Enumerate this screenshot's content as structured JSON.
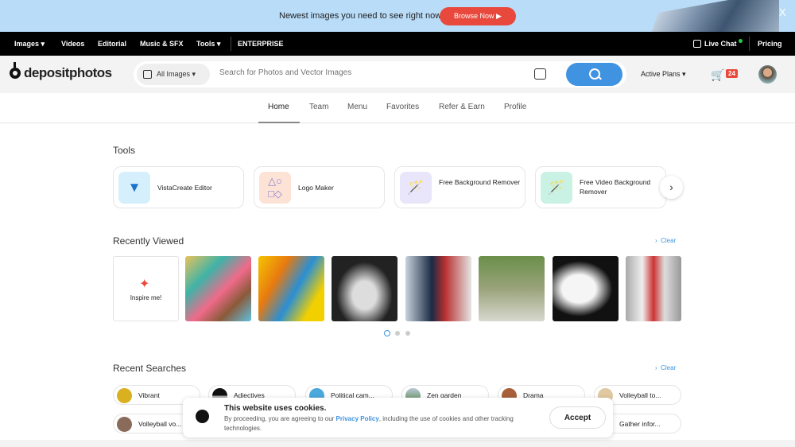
{
  "banner": {
    "text": "Newest images you need to see right now",
    "button": "Browse Now ▶",
    "close": "X"
  },
  "topnav": {
    "items": [
      "Images ▾",
      "Videos",
      "Editorial",
      "Music & SFX",
      "Tools ▾",
      "ENTERPRISE"
    ],
    "live_chat": "Live Chat",
    "pricing": "Pricing"
  },
  "header": {
    "logo": "depositphotos",
    "filter": "All Images ▾",
    "search_placeholder": "Search for Photos and Vector Images",
    "plans": "Active Plans ▾",
    "cart_count": "24"
  },
  "tabs": [
    "Home",
    "Team",
    "Menu",
    "Favorites",
    "Refer & Earn",
    "Profile"
  ],
  "tools": {
    "title": "Tools",
    "items": [
      {
        "label": "VistaCreate Editor",
        "icon": "vistacreate-logo",
        "color": "#d6effc"
      },
      {
        "label": "Logo Maker",
        "icon": "shapes-icon",
        "color": "#fde3d6"
      },
      {
        "label": "Free Background Remover",
        "icon": "magic-wand-icon",
        "color": "#e9e6fb"
      },
      {
        "label": "Free Video Background Remover",
        "icon": "magic-wand-icon",
        "color": "#c9f1e4"
      }
    ]
  },
  "recently_viewed": {
    "title": "Recently Viewed",
    "clear": "Clear",
    "inspire": "Inspire me!"
  },
  "recent_searches": {
    "title": "Recent Searches",
    "clear": "Clear",
    "chips": [
      "Vibrant",
      "Adjectives",
      "Political cam...",
      "Zen garden",
      "Drama",
      "Volleyball to...",
      "Volleyball vo...",
      "Gather infor..."
    ]
  },
  "cookie": {
    "title": "This website uses cookies.",
    "pre": "By proceeding, you are agreeing to our ",
    "link": "Privacy Policy",
    "post": ", including the use of cookies and other tracking technologies.",
    "accept": "Accept"
  }
}
